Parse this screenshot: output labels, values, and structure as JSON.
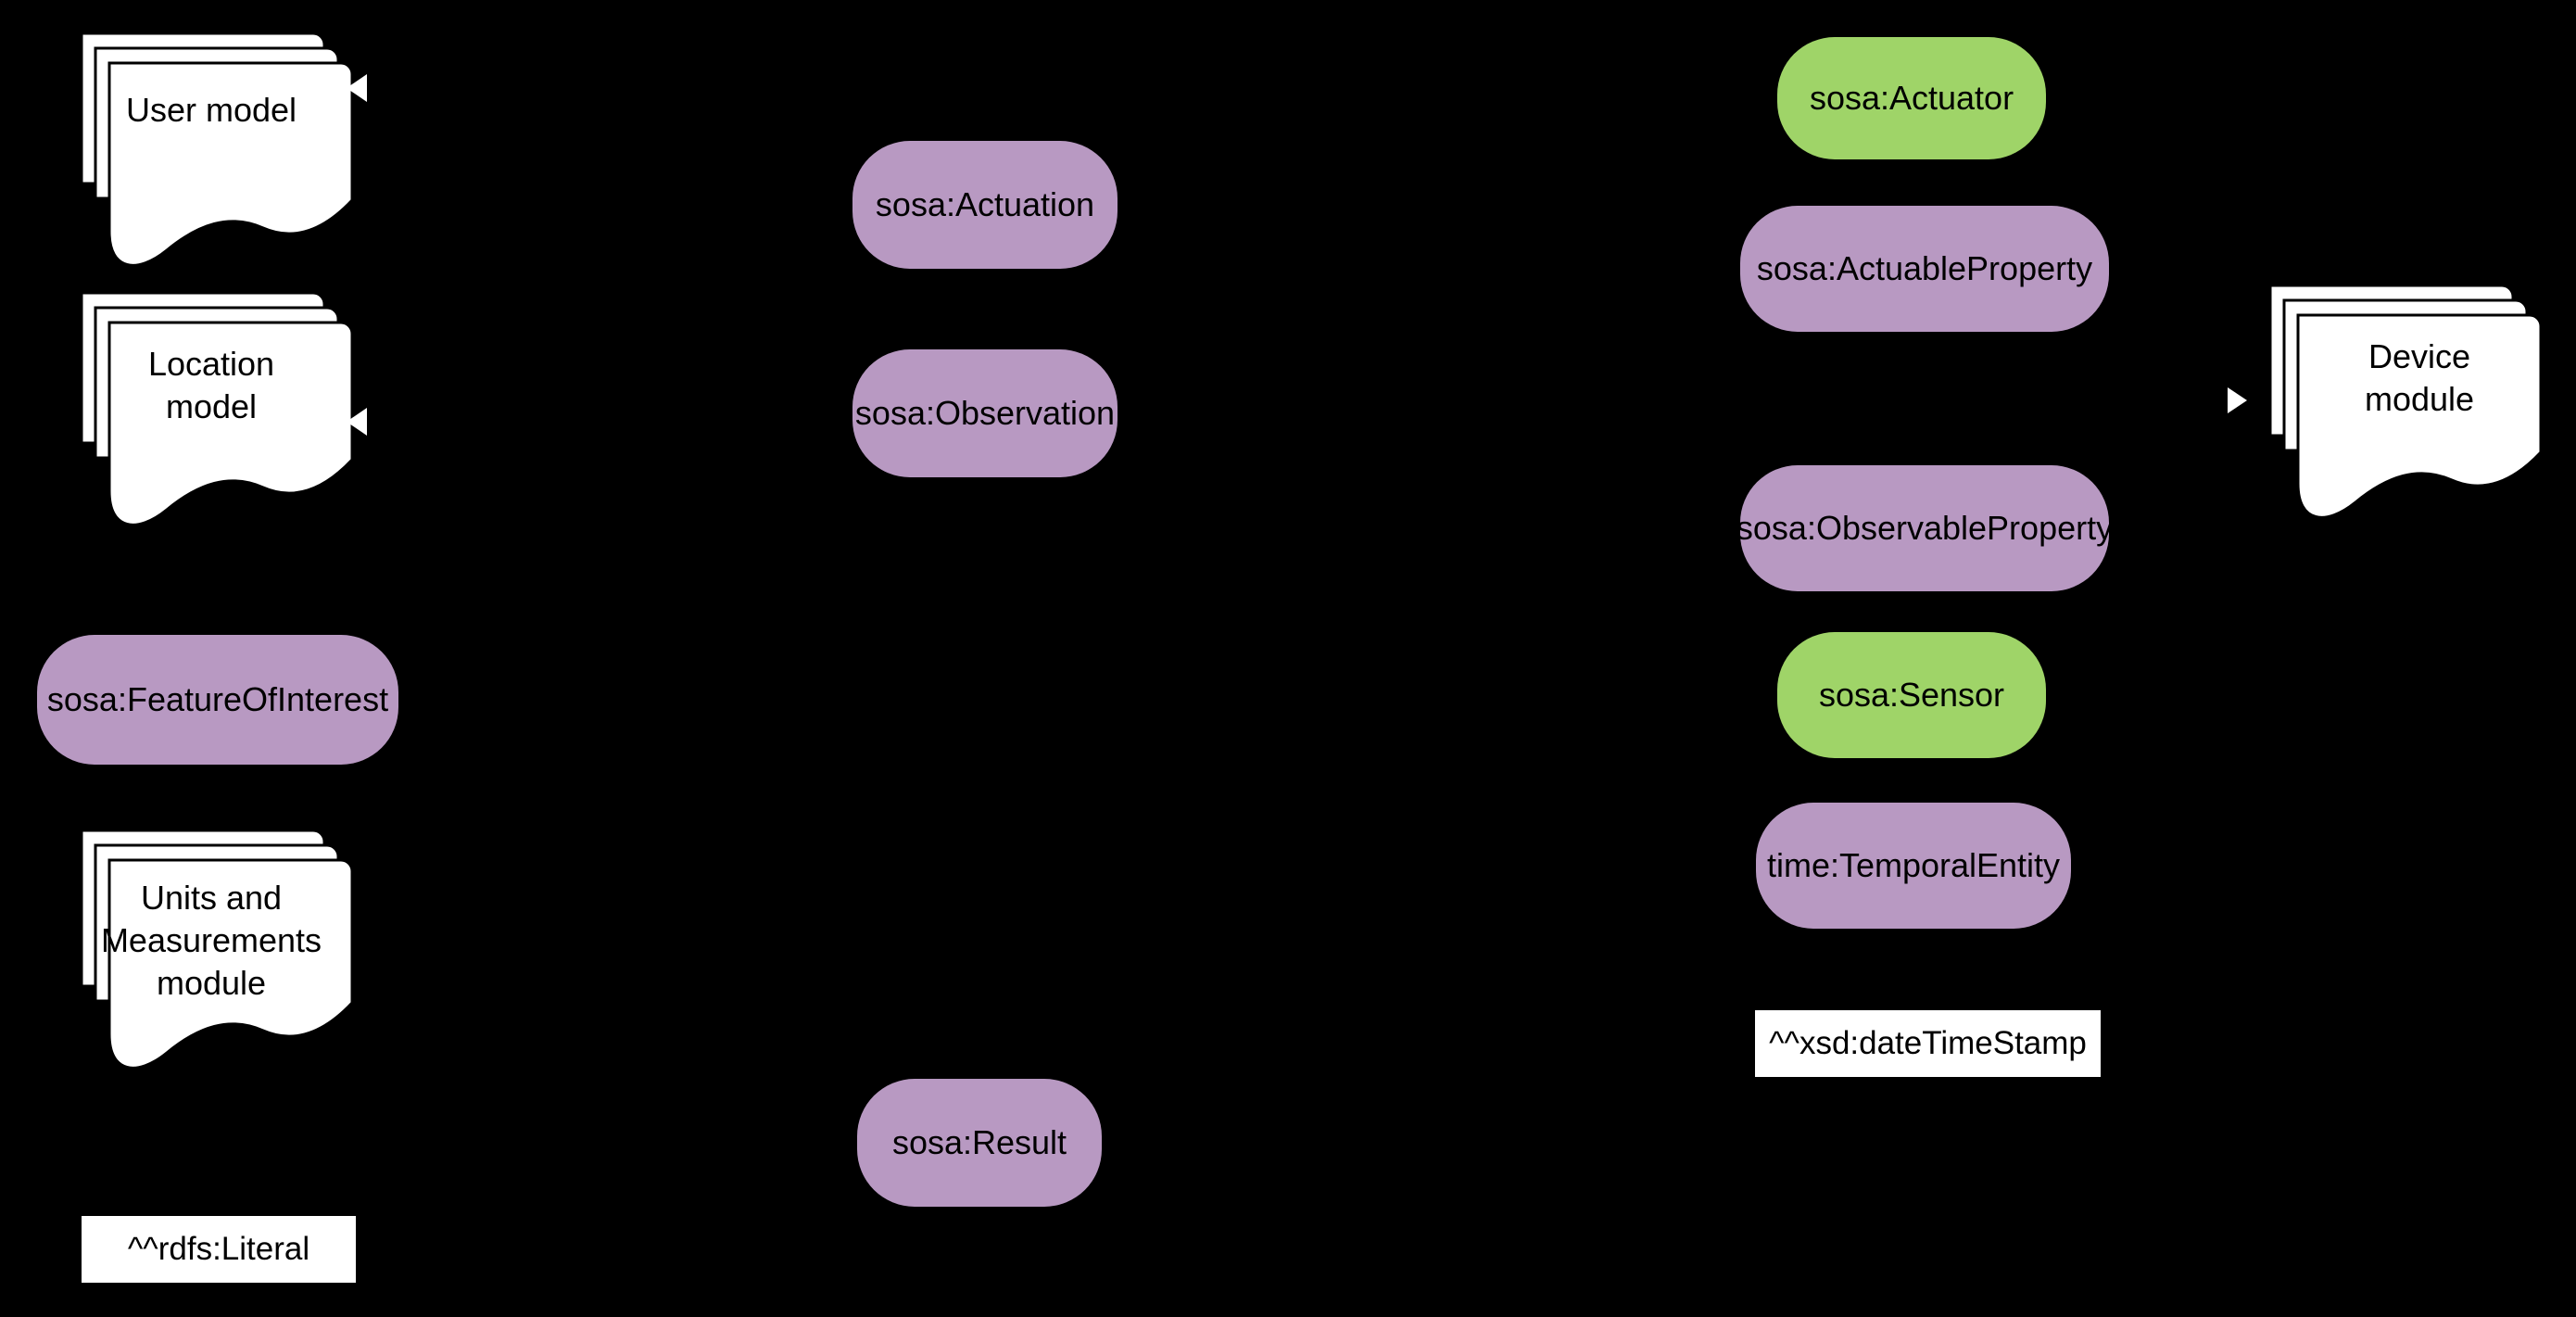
{
  "diagram": {
    "background_color": "#000000",
    "palette": {
      "class_purple": "#b899c2",
      "device_green": "#9fd468",
      "module_white": "#ffffff",
      "text_black": "#000000"
    },
    "modules": [
      {
        "id": "user-model",
        "label": "User model",
        "label_lines": [
          "User model"
        ],
        "marker": "triangle-left"
      },
      {
        "id": "location-model",
        "label": "Location model",
        "label_lines": [
          "Location",
          "model"
        ],
        "marker": "triangle-left"
      },
      {
        "id": "units-and-measurements-module",
        "label": "Units and Measurements module",
        "label_lines": [
          "Units and",
          "Measurements",
          "module"
        ],
        "marker": "none"
      },
      {
        "id": "device-module",
        "label": "Device module",
        "label_lines": [
          "Device",
          "module"
        ],
        "marker": "triangle-right"
      }
    ],
    "classes": [
      {
        "id": "sosa-feature-of-interest",
        "label": "sosa:FeatureOfInterest",
        "color": "#b899c2"
      },
      {
        "id": "sosa-actuation",
        "label": "sosa:Actuation",
        "color": "#b899c2"
      },
      {
        "id": "sosa-observation",
        "label": "sosa:Observation",
        "color": "#b899c2"
      },
      {
        "id": "sosa-result",
        "label": "sosa:Result",
        "color": "#b899c2"
      },
      {
        "id": "sosa-actuator",
        "label": "sosa:Actuator",
        "color": "#9fd468"
      },
      {
        "id": "sosa-actuable-property",
        "label": "sosa:ActuableProperty",
        "color": "#b899c2"
      },
      {
        "id": "sosa-observable-property",
        "label": "sosa:ObservableProperty",
        "color": "#b899c2"
      },
      {
        "id": "sosa-sensor",
        "label": "sosa:Sensor",
        "color": "#9fd468"
      },
      {
        "id": "time-temporal-entity",
        "label": "time:TemporalEntity",
        "color": "#b899c2"
      }
    ],
    "datatypes": [
      {
        "id": "xsd-date-time-stamp",
        "label": "^^xsd:dateTimeStamp"
      },
      {
        "id": "rdfs-literal",
        "label": "^^rdfs:Literal"
      }
    ]
  }
}
